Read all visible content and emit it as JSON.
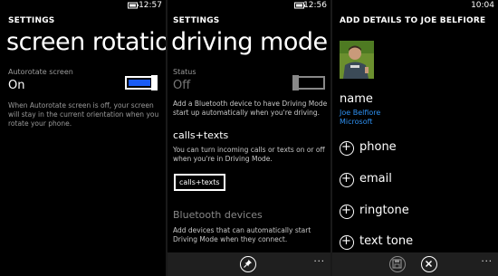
{
  "panel1": {
    "status": {
      "time": "12:57",
      "battery_icon": "battery-icon"
    },
    "section_title": "SETTINGS",
    "page_title": "screen rotation",
    "autorotate_label": "Autorotate screen",
    "autorotate_value": "On",
    "toggle_on": true,
    "description": "When Autorotate screen is off, your screen will stay in the current orientation when you rotate your phone."
  },
  "panel2": {
    "status": {
      "time": "12:56",
      "battery_icon": "battery-icon"
    },
    "section_title": "SETTINGS",
    "page_title": "driving mode",
    "status_label": "Status",
    "status_value": "Off",
    "toggle_on": false,
    "status_description": "Add a Bluetooth device to have Driving Mode start up automatically when you're driving.",
    "calls_heading": "calls+texts",
    "calls_description": "You can turn incoming calls or texts on or off when you're in Driving Mode.",
    "calls_button": "calls+texts",
    "bluetooth_heading": "Bluetooth devices",
    "bluetooth_description": "Add devices that can automatically start Driving Mode when they connect.",
    "appbar": {
      "pin_icon": "pin-icon",
      "more": "..."
    }
  },
  "panel3": {
    "status": {
      "time": "10:04",
      "battery_icon": "battery-icon"
    },
    "section_title": "ADD DETAILS TO JOE BELFIORE",
    "name_label": "name",
    "first_name": "Joe Belfiore",
    "company": "Microsoft",
    "rows": [
      {
        "label": "phone"
      },
      {
        "label": "email"
      },
      {
        "label": "ringtone"
      },
      {
        "label": "text tone"
      }
    ],
    "appbar": {
      "save_icon": "save-icon",
      "cancel_icon": "close-icon",
      "more": "..."
    }
  },
  "colors": {
    "accent": "#1a5cf5",
    "link": "#2d8ff0",
    "background": "#000000"
  }
}
